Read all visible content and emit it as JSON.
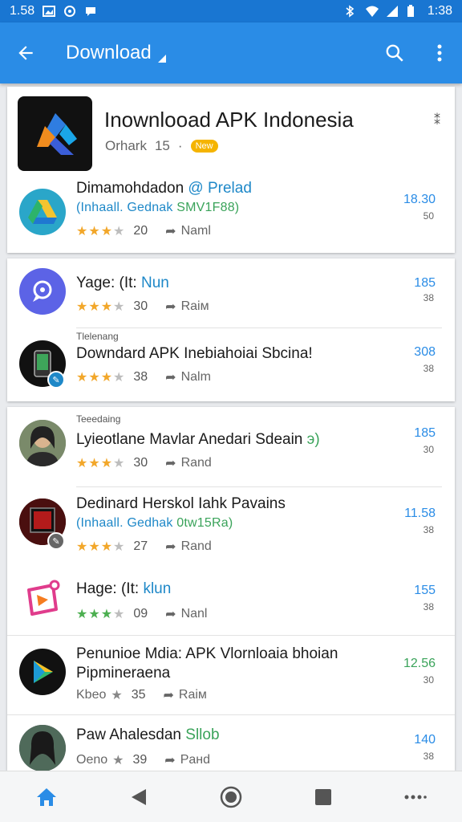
{
  "status_bar": {
    "time_left": "1.58",
    "time_right": "1:38"
  },
  "app_bar": {
    "title": "Download"
  },
  "featured": {
    "title": "Inownlooad APK Indonesia",
    "meta_text": "Orhark",
    "meta_num": "15",
    "meta_dot": "·",
    "badge": "New",
    "more": "⁑"
  },
  "rows": [
    {
      "title": "Dimamohdadon",
      "title_accent": "@ Prelad",
      "sub": "(Inhaall. Gednak",
      "sub_accent": "SMV1F88)",
      "rating_num": "20",
      "tag": "Naml",
      "price": "18.30",
      "price_sub": "50"
    },
    {
      "title": "Yage: (It:",
      "title_accent": "Nun",
      "rating_num": "30",
      "tag": "Raiм",
      "price": "185",
      "price_sub": "38"
    },
    {
      "label": "Tlelenang",
      "title": "Downdard APK Inebiahoiai Sbcina!",
      "rating_num": "38",
      "tag": "Nalm",
      "price": "308",
      "price_sub": "38"
    },
    {
      "label": "Teeedaing",
      "title": "Lyieotlane Mavlar Anedari Sdeain",
      "title_accent": "э)",
      "rating_num": "30",
      "tag": "Rand",
      "price": "185",
      "price_sub": "30"
    },
    {
      "title": "Dedinard Herskol Iahk Pavains",
      "sub": "(Inhaall. Gedhak",
      "sub_accent": "0tw15Ra)",
      "rating_num": "27",
      "tag": "Rand",
      "price": "11.58",
      "price_sub": "38"
    },
    {
      "title": "Hage: (It:",
      "title_accent": "klun",
      "rating_num": "09",
      "tag": "Nanl",
      "price": "155",
      "price_sub": "38"
    },
    {
      "title": "Penunioe Mdia: APK Vlornloaia bhoian",
      "title2": "Pipmineraena",
      "prefix": "Kbeo",
      "rating_num": "35",
      "tag": "Raiм",
      "price": "12.56",
      "price_sub": "30"
    },
    {
      "title": "Paw Ahalesdan",
      "title_accent": "Sllob",
      "prefix": "Oeno",
      "rating_num": "39",
      "tag": "Paнd",
      "price": "140",
      "price_sub": "38"
    }
  ],
  "colors": {
    "app_bar": "#2a8ce6",
    "status_bar": "#1976d2",
    "accent": "#2a8ce6",
    "star": "#f2a72a",
    "green": "#3aa35a"
  }
}
